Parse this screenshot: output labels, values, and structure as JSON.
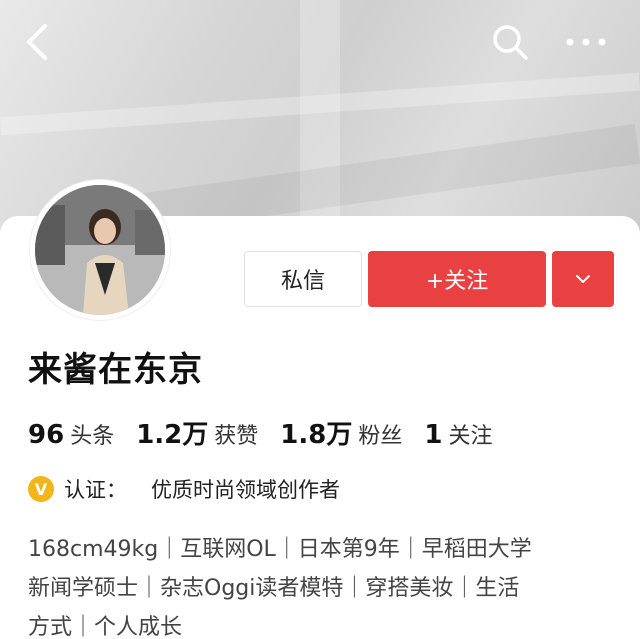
{
  "header": {
    "icons": [
      "back-arrow-icon",
      "search-icon",
      "more-icon"
    ]
  },
  "profile": {
    "name": "来酱在东京",
    "message_label": "私信",
    "follow_label": "+关注",
    "stats": [
      {
        "num": "96",
        "label": "头条"
      },
      {
        "num": "1.2万",
        "label": "获赞"
      },
      {
        "num": "1.8万",
        "label": "粉丝"
      },
      {
        "num": "1",
        "label": "关注"
      }
    ],
    "verify_label": "认证：",
    "verify_text": "优质时尚领域创作者",
    "bio_lines": [
      "168cm49kg｜互联网OL｜日本第9年｜早稻田大学",
      "新闻学硕士｜杂志Oggi读者模特｜穿搭美妆｜生活",
      "方式｜个人成长"
    ]
  },
  "colors": {
    "accent": "#e94141",
    "verify_badge": "#f2b51a"
  }
}
